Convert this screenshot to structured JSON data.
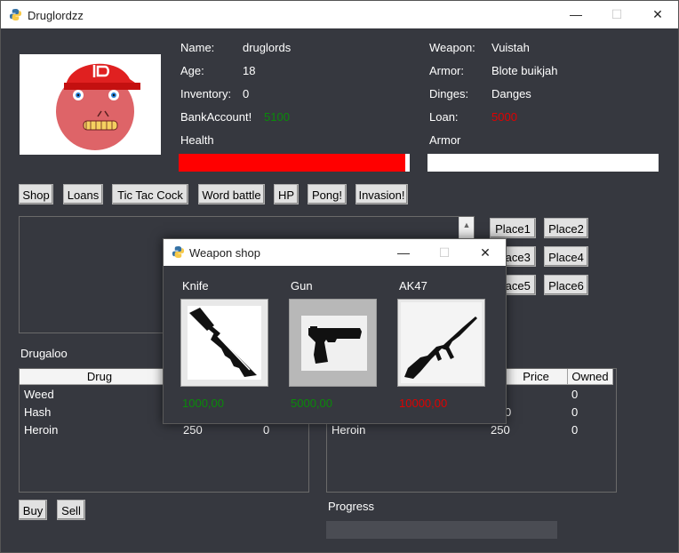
{
  "window": {
    "title": "Druglordzz",
    "minimize": "—",
    "maximize": "☐",
    "close": "✕"
  },
  "player": {
    "name_label": "Name:",
    "name_value": "druglords",
    "age_label": "Age:",
    "age_value": "18",
    "inventory_label": "Inventory:",
    "inventory_value": "0",
    "bank_label": "BankAccount!",
    "bank_value": "5100",
    "health_label": "Health",
    "health_fraction": 0.98,
    "weapon_label": "Weapon:",
    "weapon_value": "Vuistah",
    "armor_label": "Armor:",
    "armor_value": "Blote buikjah",
    "dinges_label": "Dinges:",
    "dinges_value": "Danges",
    "loan_label": "Loan:",
    "loan_value": "5000",
    "armor_bar_label": "Armor",
    "armor_fraction": 0
  },
  "toolbar": {
    "shop": "Shop",
    "loans": "Loans",
    "tictac": "Tic Tac Cock",
    "word": "Word battle",
    "hp": "HP",
    "pong": "Pong!",
    "invasion": "Invasion!"
  },
  "places": [
    "Place1",
    "Place2",
    "Place3",
    "Place4",
    "Place5",
    "Place6"
  ],
  "drug_table": {
    "title": "Drugaloo",
    "header_drug": "Drug",
    "rows": [
      {
        "drug": "Weed",
        "price": "",
        "owned": ""
      },
      {
        "drug": "Hash",
        "price": "",
        "owned": ""
      },
      {
        "drug": "Heroin",
        "price": "250",
        "owned": "0"
      }
    ]
  },
  "market_table": {
    "header_price": "Price",
    "header_owned": "Owned",
    "rows": [
      {
        "drug": "",
        "price": "",
        "owned": "0"
      },
      {
        "drug": "",
        "price": "0",
        "owned": "0"
      },
      {
        "drug": "Heroin",
        "price": "250",
        "owned": "0"
      }
    ]
  },
  "actions": {
    "buy": "Buy",
    "sell": "Sell"
  },
  "progress": {
    "label": "Progress",
    "fraction": 0
  },
  "weapon_shop": {
    "title": "Weapon shop",
    "items": [
      {
        "name": "Knife",
        "price": "1000,00",
        "price_color": "#0a8a0a",
        "icon": "knife-icon"
      },
      {
        "name": "Gun",
        "price": "5000,00",
        "price_color": "#0a8a0a",
        "icon": "pistol-icon"
      },
      {
        "name": "AK47",
        "price": "10000,00",
        "price_color": "#e00000",
        "icon": "rifle-icon"
      }
    ]
  },
  "colors": {
    "background": "#36383f",
    "health_bar": "#ff0000",
    "money_positive": "#0a8a0a",
    "money_negative": "#e00000"
  }
}
